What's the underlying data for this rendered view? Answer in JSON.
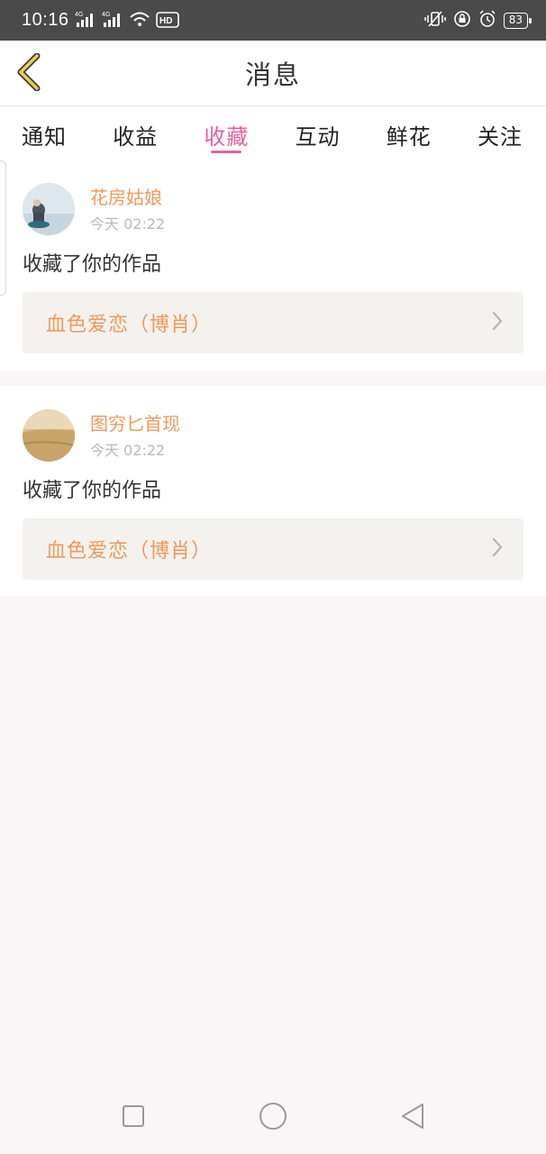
{
  "status_bar": {
    "time": "10:16",
    "signal1_label": "4G",
    "signal2_label": "4G",
    "hd_label": "HD",
    "battery": "83",
    "icons": [
      "signal-icon",
      "signal-icon",
      "wifi-icon",
      "hd-icon",
      "vibrate-icon",
      "lock-rotation-icon",
      "alarm-icon",
      "battery-icon"
    ]
  },
  "header": {
    "title": "消息",
    "back_icon": "chevron-left-icon"
  },
  "tabs": [
    {
      "label": "通知",
      "active": false
    },
    {
      "label": "收益",
      "active": false
    },
    {
      "label": "收藏",
      "active": true
    },
    {
      "label": "互动",
      "active": false
    },
    {
      "label": "鲜花",
      "active": false
    },
    {
      "label": "关注",
      "active": false
    }
  ],
  "messages": [
    {
      "user_name": "花房姑娘",
      "time": "今天 02:22",
      "action": "收藏了你的作品",
      "work_title": "血色爱恋（博肖）"
    },
    {
      "user_name": "图穷匕首现",
      "time": "今天 02:22",
      "action": "收藏了你的作品",
      "work_title": "血色爱恋（博肖）"
    }
  ],
  "nav_bar": {
    "icons": [
      "square-icon",
      "circle-icon",
      "triangle-back-icon"
    ]
  },
  "colors": {
    "accent": "#e8609e",
    "username": "#f0995c",
    "status_bar": "#4a4a4a",
    "back_icon": "#e8cf5a"
  }
}
